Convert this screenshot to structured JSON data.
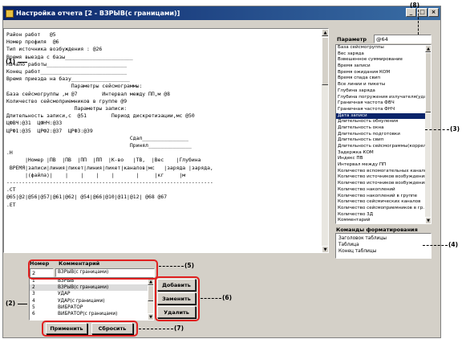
{
  "window": {
    "title": "Настройка отчета [2 - ВЗРЫВ(с границами)]",
    "min": "_",
    "max": "□",
    "close": "×"
  },
  "editor": {
    "lines": [
      "Район работ   @5",
      "Номер профиля  @6",
      "Тип источника возбуждения : @26",
      "",
      "Время выезда с базы______________________",
      "Начало работы__________________________",
      "Конец работ____________________________",
      "Время приезда на базу___________________",
      "",
      "                     Параметры сейсмограммы:",
      "База сейсмогруппы ,м @7        Интервал между ПП,м @8",
      "Количество сейсмоприемников в группе @9",
      "",
      "                      Параметры записи:",
      "Длительность записи,с  @51        Период дискретизации,мс @50",
      "ЦФВЧ:@31  ЦФНЧ:@33",
      "ЦРФ1:@35  ЦРФ2:@37  ЦРФ3:@39",
      "",
      "                                        Сдал_______________",
      "                                        Принял______________",
      ".H",
      "",
      "      |Номер |ПВ  |ПВ  |ПП  |ПП  |К-во   |ТВ,  |Вес    |Глубина",
      " ВРЕМЯ|записи|линия|пикет|линия|пикет|каналов|мс   |заряда |заряда,",
      "      |(файла)|    |    |    |    |       |     |кг     |м",
      "-------------------------------------------------------------------",
      ".CT",
      "@65|@2|@56|@57|@61|@62| @54|@66|@10|@11|@12| @68 @67",
      ".ET"
    ]
  },
  "param": {
    "label": "Параметр",
    "value": "@64"
  },
  "params_list": [
    "База сейсмогруппы",
    "Вес заряда",
    "Взвешенное суммирование",
    "Время записи",
    "Время ожидания КОМ",
    "Время спада свип",
    "Все линии и пикеты",
    "Глубина заряда",
    "Глубина погружения излучателя(удар)",
    "Граничная частота ФВЧ",
    "Граничная частота ФНЧ",
    "Дата записи",
    "Длительность обнуления",
    "Длительность окна",
    "Длительность подготовки",
    "Длительность свип",
    "Длительность сейсмограммы(коррел.)",
    "Задержка КОМ",
    "Индекс ПВ",
    "Интервал между ПП",
    "Количество вспомогательных каналов",
    "Количество источников возбуждения",
    "Количество источников возбуждения",
    "Количество накоплений",
    "Количество накоплений в группе",
    "Количество сейсмических каналов",
    "Количество сейсмоприемников в гр.",
    "Количество 3Д",
    "Комментарий"
  ],
  "params_selected": 11,
  "commands": {
    "label": "Команды форматирования",
    "items": [
      "Заголовок таблицы",
      "Таблица",
      "Конец таблицы"
    ]
  },
  "bottom": {
    "col_number": "Номер",
    "col_comment": "Комментарий",
    "current_number": "2",
    "current_comment": "ВЗРЫВ(с границами)",
    "rows": [
      {
        "n": "1",
        "c": "ВЗРЫВ"
      },
      {
        "n": "2",
        "c": "ВЗРЫВ(с границами)"
      },
      {
        "n": "3",
        "c": "УДАР"
      },
      {
        "n": "4",
        "c": "УДАР(с границами)"
      },
      {
        "n": "5",
        "c": "ВИБРАТОР"
      },
      {
        "n": "6",
        "c": "ВИБРАТОР(с границами)"
      }
    ],
    "selected_row": 1
  },
  "buttons": {
    "add": "Добавить",
    "replace": "Заменить",
    "delete": "Удалить",
    "apply": "Применить",
    "reset": "Сбросить"
  },
  "callouts": {
    "c1": "(1)",
    "c2": "(2)",
    "c3": "(3)",
    "c4": "(4)",
    "c5": "(5)",
    "c6": "(6)",
    "c7": "(7)",
    "c8": "(8)"
  },
  "colors": {
    "title_start": "#0a246a",
    "title_end": "#3a6ea5",
    "selection": "#0a246a",
    "callout_box": "#e02020",
    "window_bg": "#d4d0c8"
  }
}
